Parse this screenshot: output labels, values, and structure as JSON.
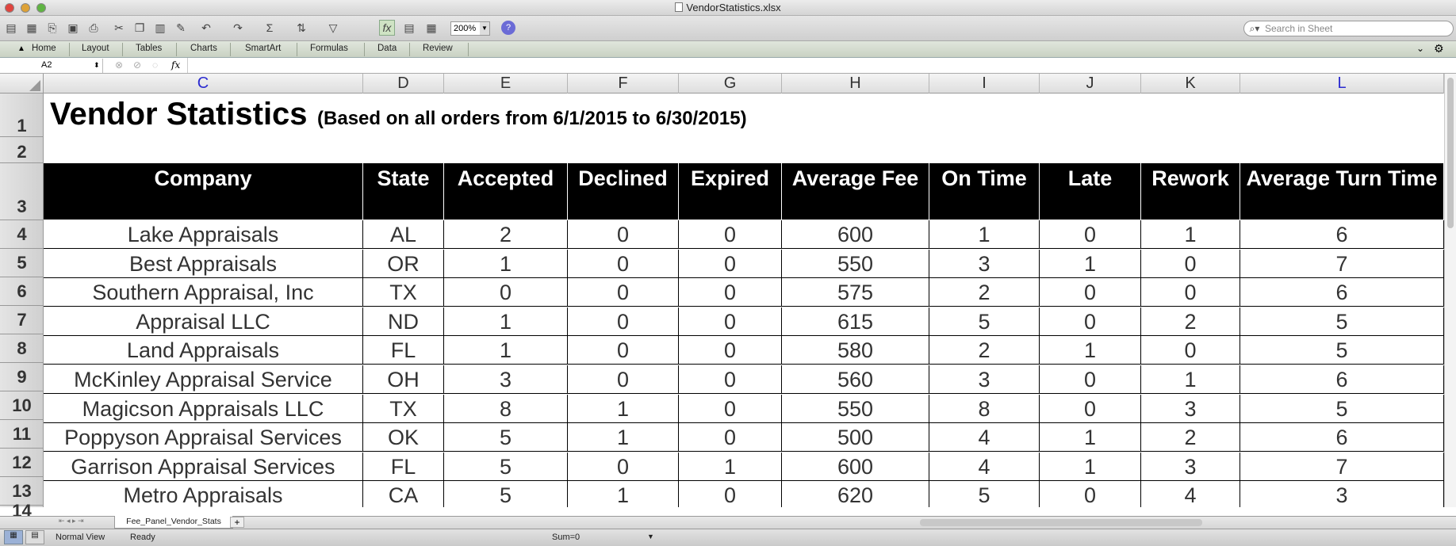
{
  "window": {
    "title": "VendorStatistics.xlsx"
  },
  "toolbar": {
    "zoom": "200%",
    "search_placeholder": "Search in Sheet"
  },
  "ribbon": {
    "tabs": [
      "Home",
      "Layout",
      "Tables",
      "Charts",
      "SmartArt",
      "Formulas",
      "Data",
      "Review"
    ]
  },
  "formula_bar": {
    "cell_ref": "A2",
    "fx": "fx"
  },
  "columns": [
    "C",
    "D",
    "E",
    "F",
    "G",
    "H",
    "I",
    "J",
    "K",
    "L"
  ],
  "rows": [
    "1",
    "2",
    "3",
    "4",
    "5",
    "6",
    "7",
    "8",
    "9",
    "10",
    "11",
    "12",
    "13",
    "14"
  ],
  "sheet": {
    "title": "Vendor Statistics",
    "subtitle": "(Based on all orders from 6/1/2015 to 6/30/2015)",
    "headers": [
      "Company",
      "State",
      "Accepted",
      "Declined",
      "Expired",
      "Average Fee",
      "On Time",
      "Late",
      "Rework",
      "Average Turn Time"
    ],
    "data": [
      [
        "Lake Appraisals",
        "AL",
        "2",
        "0",
        "0",
        "600",
        "1",
        "0",
        "1",
        "6"
      ],
      [
        "Best Appraisals",
        "OR",
        "1",
        "0",
        "0",
        "550",
        "3",
        "1",
        "0",
        "7"
      ],
      [
        "Southern Appraisal, Inc",
        "TX",
        "0",
        "0",
        "0",
        "575",
        "2",
        "0",
        "0",
        "6"
      ],
      [
        "Appraisal LLC",
        "ND",
        "1",
        "0",
        "0",
        "615",
        "5",
        "0",
        "2",
        "5"
      ],
      [
        "Land Appraisals",
        "FL",
        "1",
        "0",
        "0",
        "580",
        "2",
        "1",
        "0",
        "5"
      ],
      [
        "McKinley Appraisal Service",
        "OH",
        "3",
        "0",
        "0",
        "560",
        "3",
        "0",
        "1",
        "6"
      ],
      [
        "Magicson Appraisals LLC",
        "TX",
        "8",
        "1",
        "0",
        "550",
        "8",
        "0",
        "3",
        "5"
      ],
      [
        "Poppyson Appraisal Services",
        "OK",
        "5",
        "1",
        "0",
        "500",
        "4",
        "1",
        "2",
        "6"
      ],
      [
        "Garrison Appraisal Services",
        "FL",
        "5",
        "0",
        "1",
        "600",
        "4",
        "1",
        "3",
        "7"
      ],
      [
        "Metro Appraisals",
        "CA",
        "5",
        "1",
        "0",
        "620",
        "5",
        "0",
        "4",
        "3"
      ]
    ]
  },
  "sheet_tab": {
    "name": "Fee_Panel_Vendor_Stats",
    "add": "+"
  },
  "status": {
    "view": "Normal View",
    "ready": "Ready",
    "sum": "Sum=0"
  },
  "colors": {
    "header_bg": "#000000",
    "header_text": "#ffffff",
    "ribbon_bg": "#d4dccd"
  }
}
